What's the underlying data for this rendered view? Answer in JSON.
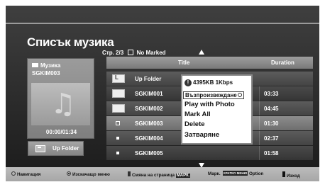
{
  "screen": {
    "title": "Списък музика",
    "page_info": "Стр. 2/3",
    "marked_label": "No Marked",
    "marked_check": "☑"
  },
  "preview": {
    "folder_name": "Музика",
    "selected_item": "SGKIM003",
    "time": "00:00/01:34",
    "icon": "music-note-icon"
  },
  "up_folder_button": {
    "label": "Up Folder",
    "icon": "folder-up-icon"
  },
  "list": {
    "columns": {
      "title": "Title",
      "duration": "Duration"
    },
    "rows": [
      {
        "type": "up-folder",
        "name": "Up Folder",
        "duration": ""
      },
      {
        "type": "folder",
        "name": "SGKIM001",
        "duration": "03:33"
      },
      {
        "type": "folder",
        "name": "SGKIM002",
        "duration": "04:45"
      },
      {
        "type": "file",
        "name": "SGKIM003",
        "duration": "01:30"
      },
      {
        "type": "file",
        "name": "SGKIM004",
        "duration": "02:37"
      },
      {
        "type": "file",
        "name": "SGKIM005",
        "duration": "01:58"
      }
    ],
    "selected_index": 3
  },
  "popup_menu": {
    "info": "4395KB 1Kbps",
    "items": [
      {
        "label": "Възпроизвеждане"
      },
      {
        "label": "Play with Photo"
      },
      {
        "label": "Mark All"
      },
      {
        "label": "Delete"
      },
      {
        "label": "Затваряне"
      }
    ],
    "highlighted_index": 0
  },
  "footer": {
    "navigation": "Навигация",
    "popup": "Изскачащо меню",
    "page_change": "Смяна на страница",
    "mark_key": "МАРК.",
    "mark": "Марк.",
    "option_key": "КРАТКО МЕНЮ",
    "option": "Option",
    "exit": "Изход"
  }
}
